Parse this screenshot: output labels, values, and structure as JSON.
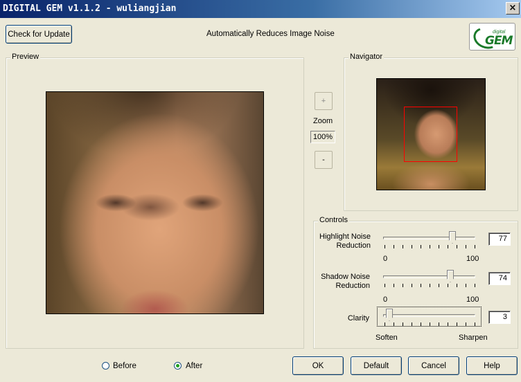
{
  "window": {
    "title": "DIGITAL GEM  v1.1.2 - wuliangjian",
    "close_glyph": "×"
  },
  "header": {
    "check_update_label": "Check for Update",
    "tagline": "Automatically Reduces Image Noise",
    "logo_small": "digital",
    "logo_text": "GEM"
  },
  "preview": {
    "label": "Preview"
  },
  "navigator": {
    "label": "Navigator"
  },
  "zoom": {
    "plus": "+",
    "label": "Zoom",
    "value": "100%",
    "minus": "-"
  },
  "controls": {
    "label": "Controls",
    "highlight": {
      "label_line1": "Highlight Noise",
      "label_line2": "Reduction",
      "value": "77",
      "min": "0",
      "max": "100"
    },
    "shadow": {
      "label_line1": "Shadow Noise",
      "label_line2": "Reduction",
      "value": "74",
      "min": "0",
      "max": "100"
    },
    "clarity": {
      "label": "Clarity",
      "value": "3",
      "min_label": "Soften",
      "max_label": "Sharpen"
    }
  },
  "view_mode": {
    "before_label": "Before",
    "after_label": "After",
    "selected": "After"
  },
  "footer": {
    "ok": "OK",
    "default": "Default",
    "cancel": "Cancel",
    "help": "Help"
  },
  "colors": {
    "title_start": "#0a246a",
    "title_end": "#a6caf0",
    "nav_rect": "#ff0000",
    "face_bg": "#ece9d8"
  }
}
